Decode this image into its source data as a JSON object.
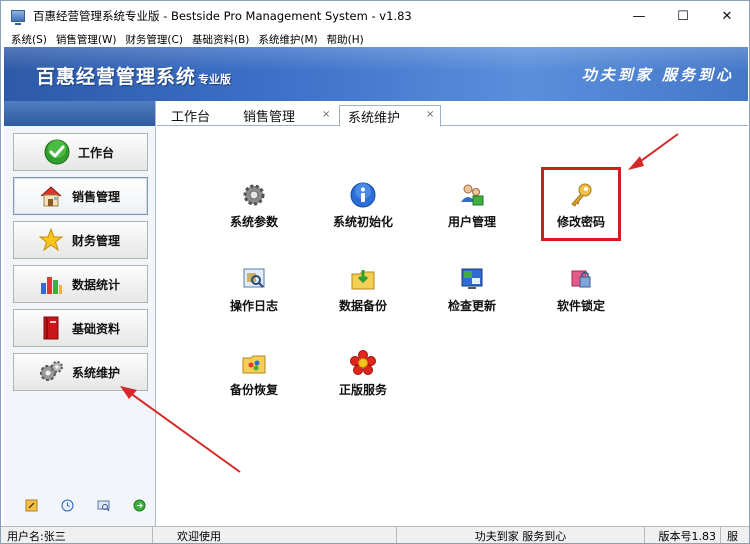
{
  "window": {
    "title": "百惠经营管理系统专业版 - Bestside Pro Management System - v1.83",
    "minimize_glyph": "—",
    "maximize_glyph": "☐",
    "close_glyph": "✕"
  },
  "menu": {
    "items": [
      "系统(S)",
      "销售管理(W)",
      "财务管理(C)",
      "基础资料(B)",
      "系统维护(M)",
      "帮助(H)"
    ]
  },
  "banner": {
    "title": "百惠经营管理系统",
    "title_suffix": "专业版",
    "slogan": "功夫到家 服务到心"
  },
  "sidebar": {
    "items": [
      {
        "label": "工作台",
        "icon": "check-icon"
      },
      {
        "label": "销售管理",
        "icon": "house-icon"
      },
      {
        "label": "财务管理",
        "icon": "star-icon"
      },
      {
        "label": "数据统计",
        "icon": "bar-chart-icon"
      },
      {
        "label": "基础资料",
        "icon": "book-icon"
      },
      {
        "label": "系统维护",
        "icon": "gears-icon"
      }
    ],
    "active_index": 1,
    "tools": [
      "edit-icon",
      "clock-icon",
      "search-icon",
      "exit-icon"
    ]
  },
  "tabs": [
    {
      "label": "工作台",
      "closable": false
    },
    {
      "label": "销售管理",
      "closable": true
    },
    {
      "label": "系统维护",
      "closable": true,
      "active": true
    }
  ],
  "tab_close_glyph": "×",
  "main": {
    "items": [
      {
        "label": "系统参数",
        "icon": "gear-icon"
      },
      {
        "label": "系统初始化",
        "icon": "info-icon"
      },
      {
        "label": "用户管理",
        "icon": "users-icon"
      },
      {
        "label": "修改密码",
        "icon": "key-icon",
        "highlighted": true
      },
      {
        "label": "操作日志",
        "icon": "log-icon"
      },
      {
        "label": "数据备份",
        "icon": "backup-folder-icon"
      },
      {
        "label": "检查更新",
        "icon": "update-icon"
      },
      {
        "label": "软件锁定",
        "icon": "lock-icon"
      },
      {
        "label": "备份恢复",
        "icon": "restore-icon"
      },
      {
        "label": "正版服务",
        "icon": "flower-icon"
      }
    ]
  },
  "statusbar": {
    "user": "用户名:张三",
    "welcome": "欢迎使用",
    "slogan": "功夫到家 服务到心",
    "version": "版本号1.83",
    "extra": "服"
  },
  "colors": {
    "banner": "#3c6fc6",
    "highlight": "#d21d1d",
    "arrow": "#d62828"
  }
}
